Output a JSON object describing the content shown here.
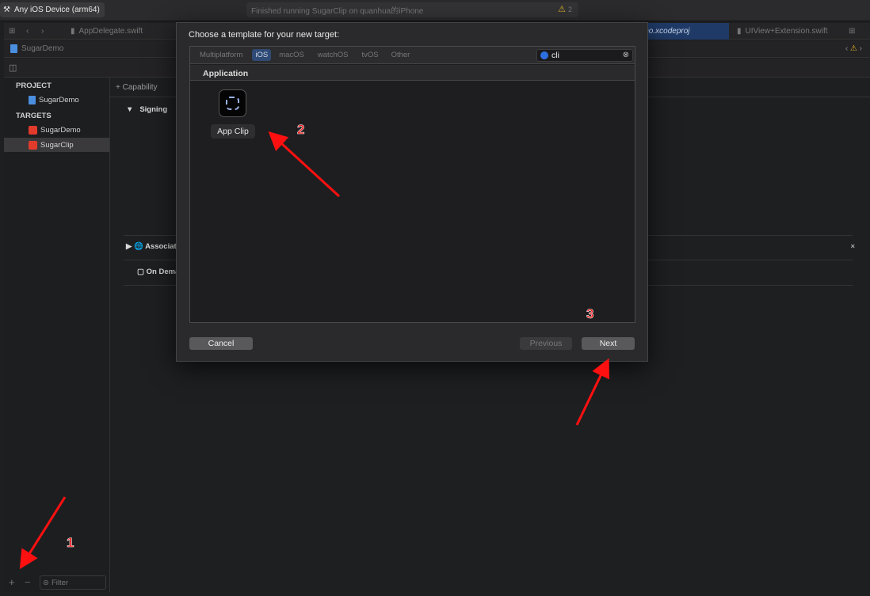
{
  "toolbar": {
    "scheme": "Any iOS Device (arm64)",
    "status": "Finished running SugarClip on quanhua的iPhone",
    "warning_count": "2"
  },
  "tabs": [
    {
      "label": "AppDelegate.swift"
    },
    {
      "label": "SugarDemo.xcodeproj"
    },
    {
      "label": "UIView+Extension.swift"
    }
  ],
  "pathbar": {
    "label": "SugarDemo"
  },
  "sidebar": {
    "project_header": "PROJECT",
    "project": "SugarDemo",
    "targets_header": "TARGETS",
    "targets": [
      {
        "label": "SugarDemo"
      },
      {
        "label": "SugarClip"
      }
    ],
    "filter_placeholder": "Filter"
  },
  "editor": {
    "capability": "+ Capability",
    "signing": "Signing",
    "associated": "Associated Domains",
    "on_demand": "On Demand Resources"
  },
  "dialog": {
    "title": "Choose a template for your new target:",
    "platforms": [
      "Multiplatform",
      "iOS",
      "macOS",
      "watchOS",
      "tvOS",
      "Other"
    ],
    "search_value": "cli",
    "section": "Application",
    "template": "App Clip",
    "cancel": "Cancel",
    "previous": "Previous",
    "next": "Next"
  },
  "annotations": [
    "1",
    "2",
    "3"
  ],
  "colors": {
    "accent": "#2f5a9e",
    "annotation": "#ff1010",
    "warning": "#e1b32a"
  }
}
